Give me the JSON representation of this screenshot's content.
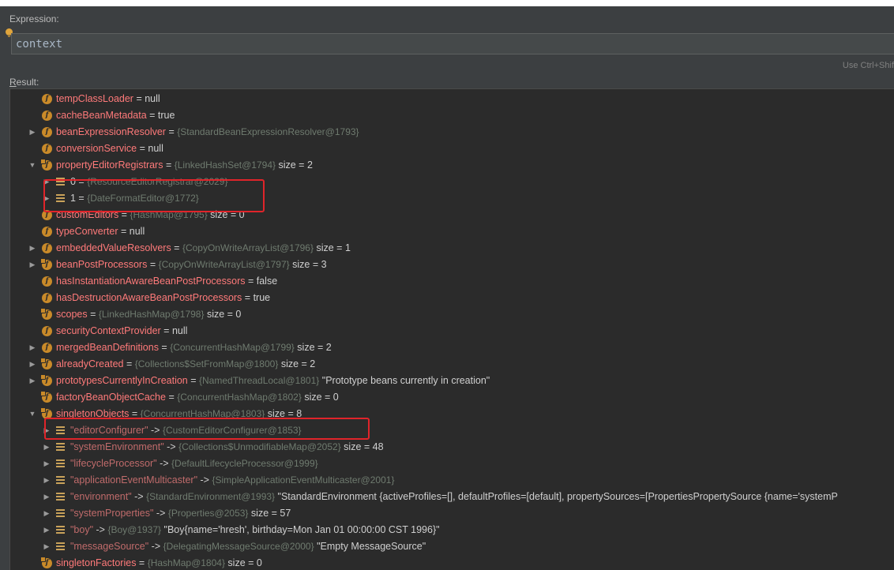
{
  "expression": {
    "label": "Expression:",
    "value": "context",
    "hint": "Use Ctrl+Shif"
  },
  "result": {
    "label_first": "R",
    "label_rest": "esult:"
  },
  "colors": {
    "field": "#ff7a7a",
    "key": "#c06b6b",
    "value": "#d0d0d0",
    "summary": "#6f7b6f",
    "highlight": "#e0242a",
    "icon": "#c98a29"
  },
  "rows": [
    {
      "lvl": 0,
      "exp": "",
      "icon": "field",
      "lock": false,
      "name": "tempClassLoader",
      "eq": " = ",
      "summ": "",
      "val": "null"
    },
    {
      "lvl": 0,
      "exp": "",
      "icon": "field",
      "lock": false,
      "name": "cacheBeanMetadata",
      "eq": " = ",
      "summ": "",
      "val": "true"
    },
    {
      "lvl": 0,
      "exp": "collapsed",
      "icon": "field",
      "lock": false,
      "name": "beanExpressionResolver",
      "eq": " = ",
      "summ": "{StandardBeanExpressionResolver@1793}",
      "val": ""
    },
    {
      "lvl": 0,
      "exp": "",
      "icon": "field",
      "lock": false,
      "name": "conversionService",
      "eq": " = ",
      "summ": "",
      "val": "null"
    },
    {
      "lvl": 0,
      "exp": "expanded",
      "icon": "field",
      "lock": true,
      "name": "propertyEditorRegistrars",
      "eq": " = ",
      "summ": "{LinkedHashSet@1794}",
      "val": " size = 2"
    },
    {
      "lvl": 1,
      "exp": "collapsed",
      "icon": "list",
      "lock": false,
      "name": "0",
      "eq": " = ",
      "summ": "{ResourceEditorRegistrar@2029}",
      "val": ""
    },
    {
      "lvl": 1,
      "exp": "collapsed",
      "icon": "list",
      "lock": false,
      "name": "1",
      "eq": " = ",
      "summ": "{DateFormatEditor@1772}",
      "val": ""
    },
    {
      "lvl": 0,
      "exp": "",
      "icon": "field",
      "lock": false,
      "name": "customEditors",
      "eq": " = ",
      "summ": "{HashMap@1795}",
      "val": " size = 0"
    },
    {
      "lvl": 0,
      "exp": "",
      "icon": "field",
      "lock": false,
      "name": "typeConverter",
      "eq": " = ",
      "summ": "",
      "val": "null"
    },
    {
      "lvl": 0,
      "exp": "collapsed",
      "icon": "field",
      "lock": false,
      "name": "embeddedValueResolvers",
      "eq": " = ",
      "summ": "{CopyOnWriteArrayList@1796}",
      "val": " size = 1"
    },
    {
      "lvl": 0,
      "exp": "collapsed",
      "icon": "field",
      "lock": true,
      "name": "beanPostProcessors",
      "eq": " = ",
      "summ": "{CopyOnWriteArrayList@1797}",
      "val": " size = 3"
    },
    {
      "lvl": 0,
      "exp": "",
      "icon": "field",
      "lock": false,
      "name": "hasInstantiationAwareBeanPostProcessors",
      "eq": " = ",
      "summ": "",
      "val": "false"
    },
    {
      "lvl": 0,
      "exp": "",
      "icon": "field",
      "lock": false,
      "name": "hasDestructionAwareBeanPostProcessors",
      "eq": " = ",
      "summ": "",
      "val": "true"
    },
    {
      "lvl": 0,
      "exp": "",
      "icon": "field",
      "lock": true,
      "name": "scopes",
      "eq": " = ",
      "summ": "{LinkedHashMap@1798}",
      "val": " size = 0"
    },
    {
      "lvl": 0,
      "exp": "",
      "icon": "field",
      "lock": false,
      "name": "securityContextProvider",
      "eq": " = ",
      "summ": "",
      "val": "null"
    },
    {
      "lvl": 0,
      "exp": "collapsed",
      "icon": "field",
      "lock": false,
      "name": "mergedBeanDefinitions",
      "eq": " = ",
      "summ": "{ConcurrentHashMap@1799}",
      "val": " size = 2"
    },
    {
      "lvl": 0,
      "exp": "collapsed",
      "icon": "field",
      "lock": true,
      "name": "alreadyCreated",
      "eq": " = ",
      "summ": "{Collections$SetFromMap@1800}",
      "val": " size = 2"
    },
    {
      "lvl": 0,
      "exp": "collapsed",
      "icon": "field",
      "lock": true,
      "name": "prototypesCurrentlyInCreation",
      "eq": " = ",
      "summ": "{NamedThreadLocal@1801}",
      "val": " \"Prototype beans currently in creation\""
    },
    {
      "lvl": 0,
      "exp": "",
      "icon": "field",
      "lock": true,
      "name": "factoryBeanObjectCache",
      "eq": " = ",
      "summ": "{ConcurrentHashMap@1802}",
      "val": " size = 0"
    },
    {
      "lvl": 0,
      "exp": "expanded",
      "icon": "field",
      "lock": true,
      "name": "singletonObjects",
      "eq": " = ",
      "summ": "{ConcurrentHashMap@1803}",
      "val": " size = 8"
    },
    {
      "lvl": 1,
      "exp": "collapsed",
      "icon": "list",
      "lock": false,
      "key": true,
      "name": "\"editorConfigurer\"",
      "eq": " -> ",
      "summ": "{CustomEditorConfigurer@1853}",
      "val": ""
    },
    {
      "lvl": 1,
      "exp": "collapsed",
      "icon": "list",
      "lock": false,
      "key": true,
      "name": "\"systemEnvironment\"",
      "eq": " -> ",
      "summ": "{Collections$UnmodifiableMap@2052}",
      "val": " size = 48"
    },
    {
      "lvl": 1,
      "exp": "collapsed",
      "icon": "list",
      "lock": false,
      "key": true,
      "name": "\"lifecycleProcessor\"",
      "eq": " -> ",
      "summ": "{DefaultLifecycleProcessor@1999}",
      "val": ""
    },
    {
      "lvl": 1,
      "exp": "collapsed",
      "icon": "list",
      "lock": false,
      "key": true,
      "name": "\"applicationEventMulticaster\"",
      "eq": " -> ",
      "summ": "{SimpleApplicationEventMulticaster@2001}",
      "val": ""
    },
    {
      "lvl": 1,
      "exp": "collapsed",
      "icon": "list",
      "lock": false,
      "key": true,
      "name": "\"environment\"",
      "eq": " -> ",
      "summ": "{StandardEnvironment@1993}",
      "val": " \"StandardEnvironment {activeProfiles=[], defaultProfiles=[default], propertySources=[PropertiesPropertySource {name='systemP"
    },
    {
      "lvl": 1,
      "exp": "collapsed",
      "icon": "list",
      "lock": false,
      "key": true,
      "name": "\"systemProperties\"",
      "eq": " -> ",
      "summ": "{Properties@2053}",
      "val": " size = 57"
    },
    {
      "lvl": 1,
      "exp": "collapsed",
      "icon": "list",
      "lock": false,
      "key": true,
      "name": "\"boy\"",
      "eq": " -> ",
      "summ": "{Boy@1937}",
      "val": " \"Boy{name='hresh', birthday=Mon Jan 01 00:00:00 CST 1996}\""
    },
    {
      "lvl": 1,
      "exp": "collapsed",
      "icon": "list",
      "lock": false,
      "key": true,
      "name": "\"messageSource\"",
      "eq": " -> ",
      "summ": "{DelegatingMessageSource@2000}",
      "val": " \"Empty MessageSource\""
    },
    {
      "lvl": 0,
      "exp": "",
      "icon": "field",
      "lock": true,
      "name": "singletonFactories",
      "eq": " = ",
      "summ": "{HashMap@1804}",
      "val": " size = 0"
    }
  ]
}
